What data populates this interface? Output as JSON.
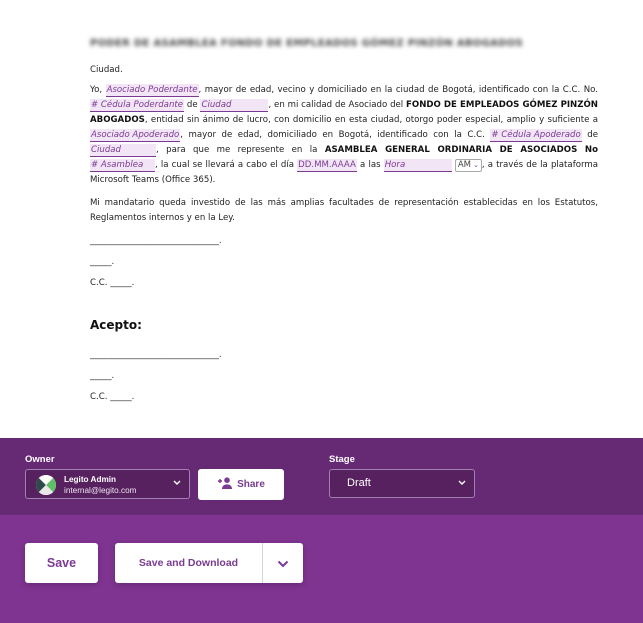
{
  "document": {
    "title_blurred": "PODER DE ASAMBLEA FONDO DE EMPLEADOS GÓMEZ PINZÓN ABOGADOS",
    "city_line": "Ciudad.",
    "p1": {
      "t1": "Yo, ",
      "f_poderdante": "Asociado Poderdante",
      "t2": ", mayor de edad, vecino y domiciliado en la ciudad de Bogotá, identificado con la C.C. No. ",
      "f_cedula_poderdante": "# Cédula Poderdante",
      "t3": " de ",
      "f_ciudad1": "Ciudad",
      "t4": ", en mi calidad de Asociado del ",
      "b_fondo": "FONDO DE EMPLEADOS GÓMEZ PINZÓN ABOGADOS",
      "t5": ", entidad sin ánimo de lucro, con domicilio en esta ciudad, otorgo poder especial, amplio y suficiente a ",
      "f_apoderado": "Asociado Apoderado",
      "t6": ", mayor de edad, domiciliado en Bogotá, identificado con la C.C. ",
      "f_cedula_apoderado": "# Cédula Apoderado",
      "t7": " de ",
      "f_ciudad2": "Ciudad",
      "t8": ", para que me represente en la ",
      "b_asamblea": "ASAMBLEA GENERAL ORDINARIA DE ASOCIADOS No",
      "t9": " ",
      "f_asamblea": "# Asamblea",
      "t10": ", la cual se llevará a cabo el día ",
      "f_fecha": "DD.MM.AAAA",
      "t11": " a las ",
      "f_hora": "Hora",
      "ampm": "AM",
      "t12": ", a través de la plataforma Microsoft Teams (Office 365)."
    },
    "p2": "Mi mandatario queda investido de las más amplias facultades de representación establecidas en los Estatutos, Reglamentos internos y en la Ley.",
    "sig1_line": "______________________________.",
    "sig1_name": "_____.",
    "sig1_cc": "C.C. _____.",
    "acepto": "Acepto:",
    "sig2_line": "______________________________.",
    "sig2_name": "_____.",
    "sig2_cc": "C.C. _____."
  },
  "panel": {
    "owner_label": "Owner",
    "owner_name": "Legito Admin",
    "owner_email": "internal@legito.com",
    "share_label": "Share",
    "stage_label": "Stage",
    "stage_value": "Draft",
    "save_label": "Save",
    "save_download_label": "Save and Download"
  },
  "colors": {
    "accent": "#7b3a93",
    "owner_band": "#662a75",
    "action_band": "#7e3490",
    "field_bg": "#f2e6f6"
  }
}
